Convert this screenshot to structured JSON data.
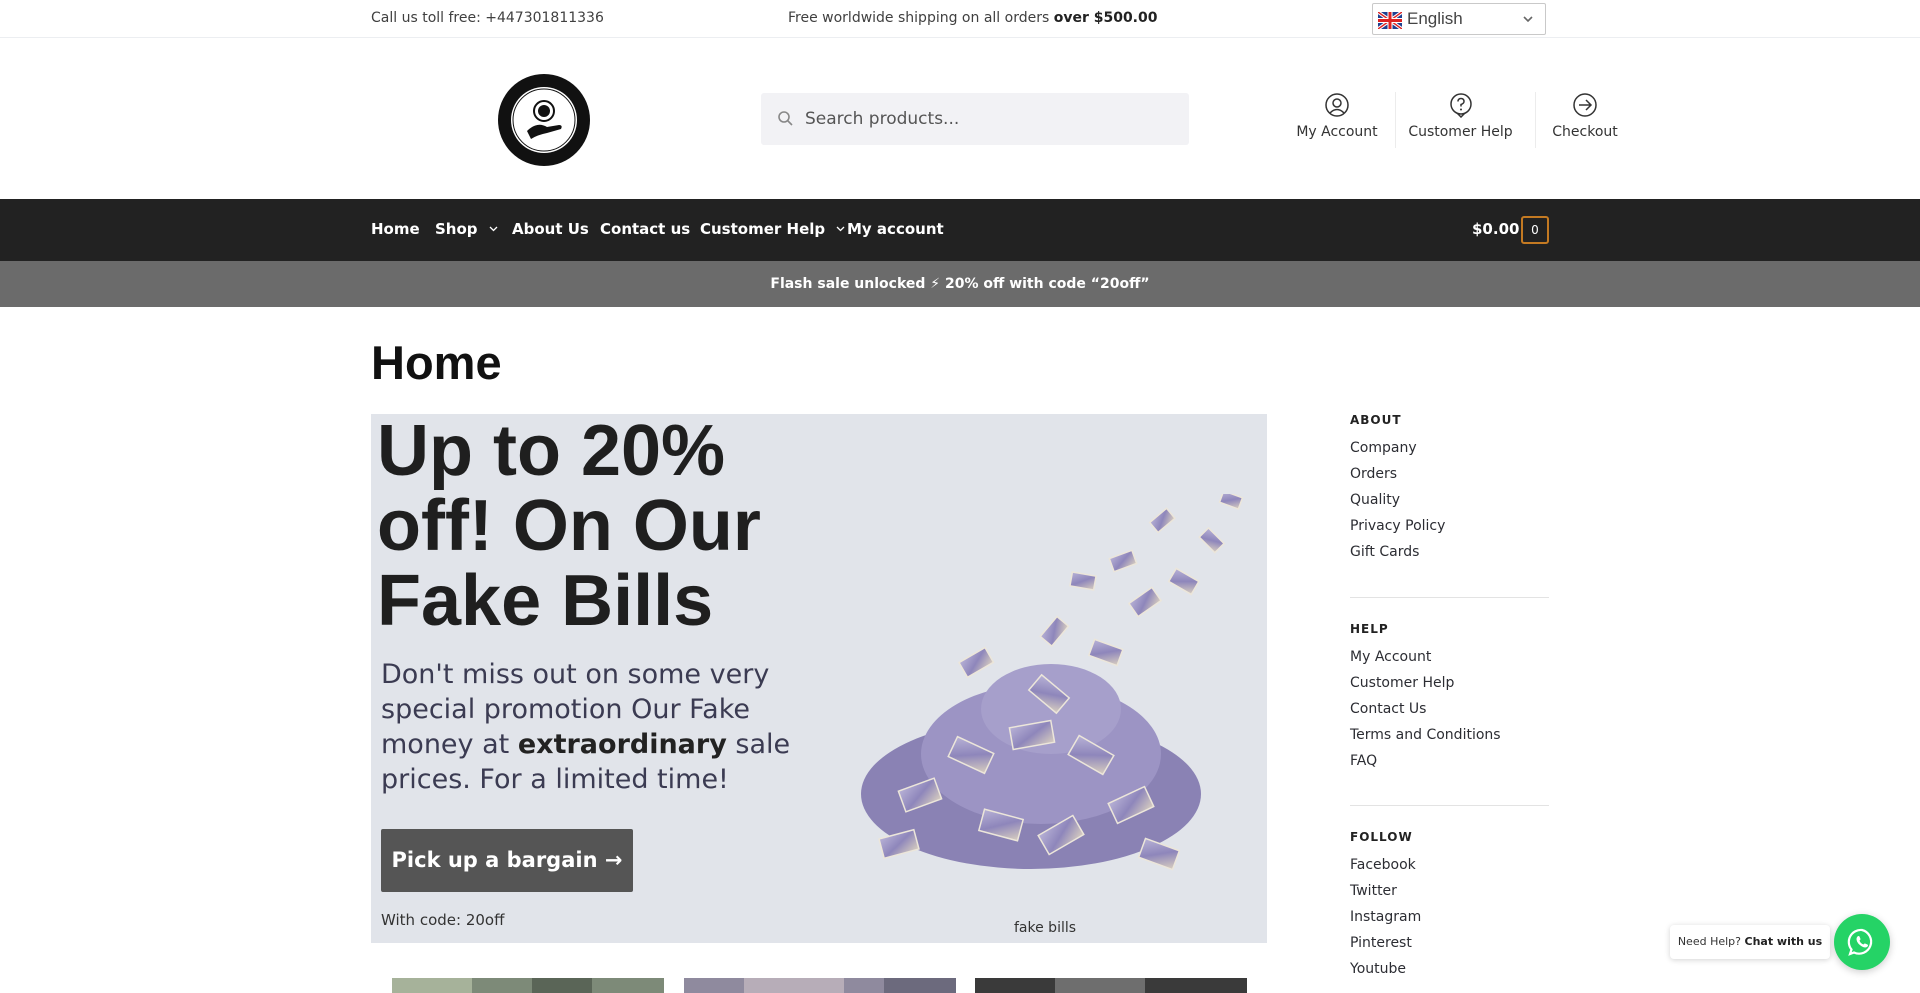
{
  "topbar": {
    "phone": "Call us toll free: +447301811336",
    "shipping_prefix": "Free worldwide shipping on all orders",
    "shipping_strong": "over $500.00",
    "language": "English"
  },
  "header": {
    "search_placeholder": "Search products...",
    "links": [
      {
        "label": "My Account",
        "icon": "user-icon"
      },
      {
        "label": "Customer Help",
        "icon": "help-icon"
      },
      {
        "label": "Checkout",
        "icon": "checkout-arrow-icon"
      }
    ]
  },
  "nav": {
    "items": [
      "Home",
      "Shop",
      "About Us",
      "Contact us",
      "Customer Help",
      "My account"
    ],
    "cart_total": "$0.00",
    "cart_count": "0"
  },
  "flash": "Flash sale unlocked ⚡ 20% off with code “20off”",
  "page": {
    "title": "Home"
  },
  "hero": {
    "heading": "Up to 20% off! On Our Fake Bills",
    "para_before": "Don't miss out on some very special promotion Our Fake money at",
    "para_strong": "extraordinary",
    "para_after": "sale prices. For a limited time!",
    "button": "Pick up a bargain →",
    "code": "With code: 20off",
    "image_caption": "fake bills"
  },
  "sidebar": {
    "about": {
      "title": "ABOUT",
      "links": [
        "Company",
        "Orders",
        "Quality",
        "Privacy Policy",
        "Gift Cards"
      ]
    },
    "help": {
      "title": "HELP",
      "links": [
        "My Account",
        "Customer Help",
        "Contact Us",
        "Terms and Conditions",
        "FAQ"
      ]
    },
    "follow": {
      "title": "FOLLOW",
      "links": [
        "Facebook",
        "Twitter",
        "Instagram",
        "Pinterest",
        "Youtube"
      ]
    }
  },
  "whatsapp": {
    "prefix": "Need Help?",
    "strong": "Chat with us"
  },
  "colors": {
    "nav_bg": "#222222",
    "flash_bg": "#6b6b6b",
    "hero_bg": "#e1e4ea",
    "button_bg": "#555555",
    "cart_badge_border": "#c47a22",
    "whatsapp": "#25d366"
  }
}
